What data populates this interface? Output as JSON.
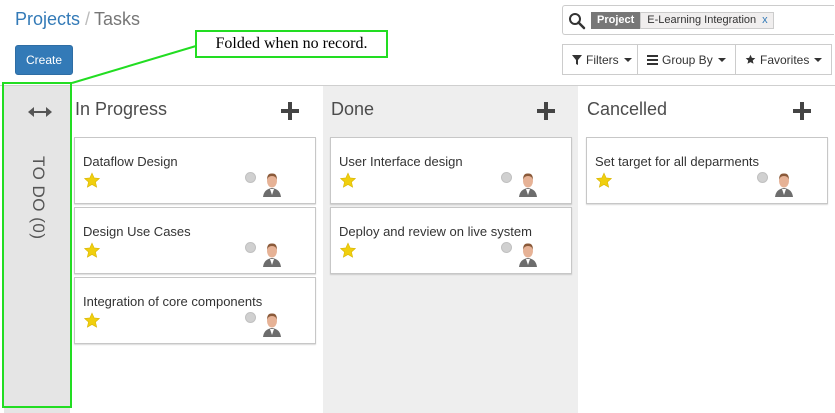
{
  "breadcrumb": {
    "parent": "Projects",
    "separator": "/",
    "current": "Tasks"
  },
  "toolbar": {
    "create_label": "Create"
  },
  "search": {
    "facet_label": "Project",
    "facet_value": "E-Learning Integration",
    "facet_remove": "x"
  },
  "search_options": {
    "filters": "Filters",
    "group_by": "Group By",
    "favorites": "Favorites"
  },
  "annotation": {
    "text": "Folded when no record."
  },
  "kanban": {
    "folded_column": {
      "title": "TO DO (0)"
    },
    "columns": [
      {
        "title": "In Progress",
        "cards": [
          {
            "title": "Dataflow Design",
            "starred": true
          },
          {
            "title": "Design Use Cases",
            "starred": true
          },
          {
            "title": "Integration of core components",
            "starred": true
          }
        ]
      },
      {
        "title": "Done",
        "cards": [
          {
            "title": "User Interface design",
            "starred": true
          },
          {
            "title": "Deploy and review on live system",
            "starred": true
          }
        ]
      },
      {
        "title": "Cancelled",
        "cards": [
          {
            "title": "Set target for all deparments",
            "starred": true
          }
        ]
      }
    ]
  },
  "colors": {
    "primary": "#337ab7",
    "star": "#f0cf0e",
    "annotation_green": "#22dd22",
    "done_column_bg": "#eeeeee",
    "folded_column_bg": "#e5e5e5"
  }
}
